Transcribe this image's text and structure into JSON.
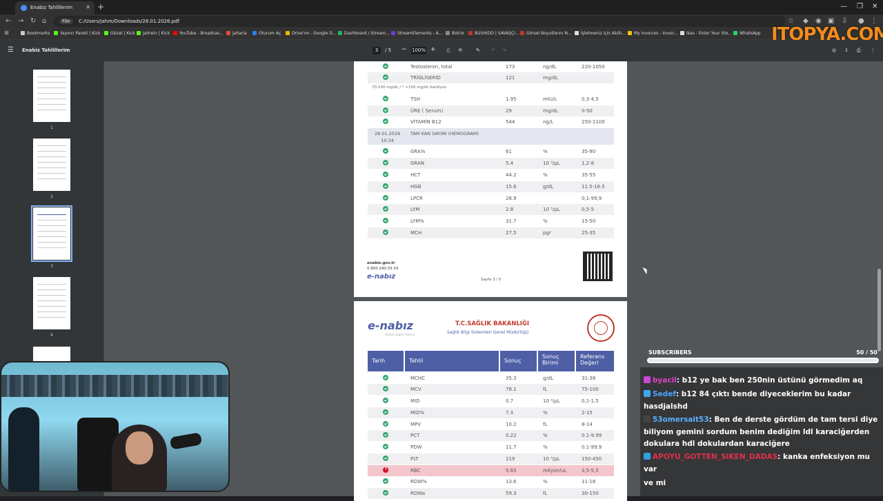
{
  "browser": {
    "tab_title": "Enabiz Tahlillerim",
    "address_chip": "File",
    "address_url": "C:/Users/jahre/Downloads/28.01.2026.pdf",
    "bookmarks": [
      "Bookmarks",
      "Yayıncı Paneli | Kick",
      "Gözat | Kick",
      "Jahrein | Kick",
      "YouTube - Broadcas...",
      "Jaharia",
      "Oturum Aç",
      "Drive'ım - Google D...",
      "Dashboard / Stream...",
      "StreamElements - A...",
      "Botrix",
      "BUSHIDO | SAVAŞÇI...",
      "Görsel Boyutlarını N...",
      "İşletmeniz için Akıllı...",
      "My Invoices - Invoic...",
      "ikas - Enter Your Sto...",
      "WhatsApp"
    ]
  },
  "watermark": "ITOPYA.COM",
  "pdf": {
    "title": "Enabiz Tahlillerim",
    "page_current": "3",
    "page_total": "/ 5",
    "zoom": "100%",
    "thumbnails": [
      "1",
      "2",
      "3",
      "4"
    ]
  },
  "page3": {
    "rows_top": [
      {
        "name": "Testosteron, total",
        "value": "173",
        "unit": "ng/dL",
        "ref": "220-1050"
      },
      {
        "name": "TRİGLİSERİD",
        "value": "121",
        "unit": "mg/dL",
        "ref": ""
      }
    ],
    "note": "70-150 mg/dL / * >150 mg/dL Kardiyov",
    "rows_mid": [
      {
        "name": "TSH",
        "value": "1.95",
        "unit": "mIU/L",
        "ref": "0,3-4,5"
      },
      {
        "name": "ÜRE ( Serum)",
        "value": "29",
        "unit": "mg/dL",
        "ref": "0-50"
      },
      {
        "name": "VİTAMİN B12",
        "value": "544",
        "unit": "ng/L",
        "ref": "250-1100"
      }
    ],
    "group_date": "28.01.2026",
    "group_time": "10:34",
    "group_title": "TAM KAN SAYIMI (HEMOGRAM)",
    "rows_hemo": [
      {
        "name": "GRA%",
        "value": "61",
        "unit": "%",
        "ref": "35-80"
      },
      {
        "name": "GRAN",
        "value": "5.4",
        "unit": "10 ³/µL",
        "ref": "1,2-8"
      },
      {
        "name": "HCT",
        "value": "44.2",
        "unit": "%",
        "ref": "35-55"
      },
      {
        "name": "HGB",
        "value": "15.6",
        "unit": "g/dL",
        "ref": "11.5-16.5"
      },
      {
        "name": "LPCR",
        "value": "28.9",
        "unit": "",
        "ref": "0,1-99,9"
      },
      {
        "name": "LYM",
        "value": "2.8",
        "unit": "10 ³/µL",
        "ref": "0,5-5"
      },
      {
        "name": "LYM%",
        "value": "31.7",
        "unit": "%",
        "ref": "15-50"
      },
      {
        "name": "MCH",
        "value": "27.5",
        "unit": "pgr",
        "ref": "25-35"
      }
    ],
    "footer_site": "enabiz.gov.tr",
    "footer_phone": "0 850 240 03 03",
    "footer_logo": "e-nabız",
    "footer_page": "Sayfa 3 / 5"
  },
  "page4": {
    "logo": "e-nabız",
    "logo_sub": "Kişisel Sağlık Sistemi",
    "ministry": "T.C.SAĞLIK BAKANLIĞI",
    "ministry_sub": "Sağlık Bilgi Sistemleri Genel Müdürlüğü",
    "headers": {
      "date": "Tarih",
      "test": "Tahlil",
      "result": "Sonuç",
      "unit": "Sonuç Birimi",
      "ref": "Referans Değeri"
    },
    "rows": [
      {
        "name": "MCHC",
        "value": "35.3",
        "unit": "g/dL",
        "ref": "31-38",
        "flag": false
      },
      {
        "name": "MCV",
        "value": "78.1",
        "unit": "fL",
        "ref": "75-100",
        "flag": false
      },
      {
        "name": "MID",
        "value": "0.7",
        "unit": "10 ³/µL",
        "ref": "0,1-1,5",
        "flag": false
      },
      {
        "name": "MID%",
        "value": "7.3",
        "unit": "%",
        "ref": "2-15",
        "flag": false
      },
      {
        "name": "MPV",
        "value": "10.2",
        "unit": "fL",
        "ref": "8-14",
        "flag": false
      },
      {
        "name": "PCT",
        "value": "0.22",
        "unit": "%",
        "ref": "0.1-9.99",
        "flag": false
      },
      {
        "name": "PDW",
        "value": "11.7",
        "unit": "%",
        "ref": "0.1-99.9",
        "flag": false
      },
      {
        "name": "PLT",
        "value": "219",
        "unit": "10 ³/µL",
        "ref": "150-450",
        "flag": false
      },
      {
        "name": "RBC",
        "value": "5.65",
        "unit": "milyon/uL",
        "ref": "3,5-5,5",
        "flag": true
      },
      {
        "name": "RDW%",
        "value": "13.6",
        "unit": "%",
        "ref": "11-16",
        "flag": false
      },
      {
        "name": "RDWa",
        "value": "59.3",
        "unit": "fL",
        "ref": "30-150",
        "flag": false
      }
    ]
  },
  "overlay": {
    "subs_label": "SUBSCRIBERS",
    "subs_count": "50",
    "subs_goal": "/ 50",
    "chat": [
      {
        "user": "byacil",
        "color": "#e040c8",
        "text": ": b12 ye bak ben 250nin üstünü görmedim aq"
      },
      {
        "user": "Sedef",
        "color": "#4da6ff",
        "text": ": b12 84 çıktı bende diyeceklerim bu kadar hasdjalshd"
      },
      {
        "user": "53omersait53",
        "color": "#5ab0ff",
        "text": ": Ben de derste gördüm de tam tersi diye biliyom gemini sordum benim dediğim ldl karaciğerden dokulara hdl dokulardan karaciğere"
      },
      {
        "user": "APOYU_GOTTEN_SIKEN_DADAS",
        "color": "#e0304a",
        "text": ": kanka enfeksiyon mu var"
      },
      {
        "user": "",
        "color": "#ffffff",
        "text": "ve mi"
      }
    ]
  }
}
